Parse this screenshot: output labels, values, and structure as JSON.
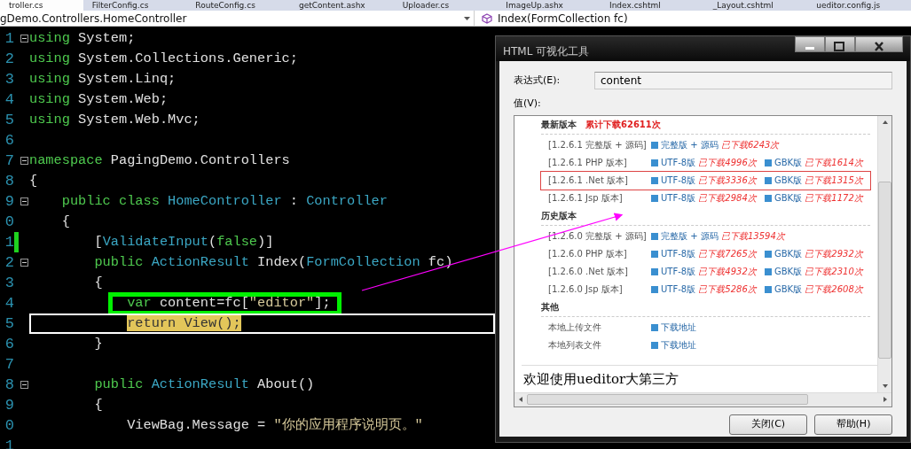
{
  "editor_tabs": [
    {
      "label": "troller.cs",
      "selected": true
    },
    {
      "label": "FilterConfig.cs",
      "selected": false
    },
    {
      "label": "RouteConfig.cs",
      "selected": false
    },
    {
      "label": "getContent.ashx",
      "selected": false
    },
    {
      "label": "Uploader.cs",
      "selected": false
    },
    {
      "label": "ImageUp.ashx",
      "selected": false
    },
    {
      "label": "Index.cshtml",
      "selected": false
    },
    {
      "label": "_Layout.cshtml",
      "selected": false
    },
    {
      "label": "ueditor.config.js",
      "selected": false
    }
  ],
  "navigation": {
    "type_dropdown": "gDemo.Controllers.HomeController",
    "member_dropdown": "Index(FormCollection fc)"
  },
  "code_lines": [
    {
      "number": "1",
      "fold": true,
      "changed": false,
      "current": false,
      "boxed": false,
      "tokens": [
        {
          "kind": "kw",
          "text": "using"
        },
        {
          "kind": "plain",
          "text": " System;"
        }
      ]
    },
    {
      "number": "2",
      "fold": false,
      "changed": false,
      "current": false,
      "boxed": false,
      "tokens": [
        {
          "kind": "kw",
          "text": "using"
        },
        {
          "kind": "plain",
          "text": " System.Collections.Generic;"
        }
      ]
    },
    {
      "number": "3",
      "fold": false,
      "changed": false,
      "current": false,
      "boxed": false,
      "tokens": [
        {
          "kind": "kw",
          "text": "using"
        },
        {
          "kind": "plain",
          "text": " System.Linq;"
        }
      ]
    },
    {
      "number": "4",
      "fold": false,
      "changed": false,
      "current": false,
      "boxed": false,
      "tokens": [
        {
          "kind": "kw",
          "text": "using"
        },
        {
          "kind": "plain",
          "text": " System.Web;"
        }
      ]
    },
    {
      "number": "5",
      "fold": false,
      "changed": false,
      "current": false,
      "boxed": false,
      "tokens": [
        {
          "kind": "kw",
          "text": "using"
        },
        {
          "kind": "plain",
          "text": " System.Web.Mvc;"
        }
      ]
    },
    {
      "number": "6",
      "fold": false,
      "changed": false,
      "current": false,
      "boxed": false
    },
    {
      "number": "7",
      "fold": true,
      "changed": false,
      "current": false,
      "boxed": false,
      "tokens": [
        {
          "kind": "kw",
          "text": "namespace"
        },
        {
          "kind": "plain",
          "text": " PagingDemo.Controllers"
        }
      ]
    },
    {
      "number": "8",
      "fold": false,
      "changed": false,
      "current": false,
      "boxed": false,
      "tokens": [
        {
          "kind": "plain",
          "text": "{"
        }
      ]
    },
    {
      "number": "9",
      "fold": true,
      "changed": false,
      "current": false,
      "boxed": false,
      "tokens": [
        {
          "kind": "kw",
          "text": "    public class"
        },
        {
          "kind": "type",
          "text": " HomeController"
        },
        {
          "kind": "plain",
          "text": " : "
        },
        {
          "kind": "type",
          "text": "Controller"
        }
      ]
    },
    {
      "number": "0",
      "fold": false,
      "changed": false,
      "current": false,
      "boxed": false,
      "tokens": [
        {
          "kind": "plain",
          "text": "    {"
        }
      ]
    },
    {
      "number": "1",
      "fold": false,
      "changed": true,
      "current": false,
      "boxed": false,
      "tokens": [
        {
          "kind": "plain",
          "text": "        ["
        },
        {
          "kind": "type",
          "text": "ValidateInput"
        },
        {
          "kind": "plain",
          "text": "("
        },
        {
          "kind": "kw",
          "text": "false"
        },
        {
          "kind": "plain",
          "text": ")]"
        }
      ]
    },
    {
      "number": "2",
      "fold": true,
      "changed": false,
      "current": false,
      "boxed": false,
      "tokens": [
        {
          "kind": "kw",
          "text": "        public"
        },
        {
          "kind": "type",
          "text": " ActionResult"
        },
        {
          "kind": "plain",
          "text": " Index("
        },
        {
          "kind": "type",
          "text": "FormCollection"
        },
        {
          "kind": "plain",
          "text": " fc)"
        }
      ]
    },
    {
      "number": "3",
      "fold": false,
      "changed": false,
      "current": false,
      "boxed": false,
      "tokens": [
        {
          "kind": "plain",
          "text": "        {"
        }
      ]
    },
    {
      "number": "4",
      "fold": false,
      "changed": false,
      "current": false,
      "boxed": true,
      "tokens": [
        {
          "kind": "kw",
          "text": "            var"
        },
        {
          "kind": "plain",
          "text": " content=fc["
        },
        {
          "kind": "str",
          "text": "\"editor\""
        },
        {
          "kind": "plain",
          "text": "];"
        }
      ]
    },
    {
      "number": "5",
      "fold": false,
      "changed": false,
      "current": true,
      "boxed": false,
      "tokens": [
        {
          "kind": "step",
          "text": "            return View();"
        }
      ]
    },
    {
      "number": "6",
      "fold": false,
      "changed": false,
      "current": false,
      "boxed": false,
      "tokens": [
        {
          "kind": "plain",
          "text": "        }"
        }
      ]
    },
    {
      "number": "7",
      "fold": false,
      "changed": false,
      "current": false,
      "boxed": false
    },
    {
      "number": "8",
      "fold": true,
      "changed": false,
      "current": false,
      "boxed": false,
      "tokens": [
        {
          "kind": "kw",
          "text": "        public"
        },
        {
          "kind": "type",
          "text": " ActionResult"
        },
        {
          "kind": "plain",
          "text": " About()"
        }
      ]
    },
    {
      "number": "9",
      "fold": false,
      "changed": false,
      "current": false,
      "boxed": false,
      "tokens": [
        {
          "kind": "plain",
          "text": "        {"
        }
      ]
    },
    {
      "number": "0",
      "fold": false,
      "changed": false,
      "current": false,
      "boxed": false,
      "tokens": [
        {
          "kind": "plain",
          "text": "            ViewBag.Message = "
        },
        {
          "kind": "str",
          "text": "\"你的应用程序说明页。\""
        }
      ]
    },
    {
      "number": "1",
      "fold": false,
      "changed": false,
      "current": false,
      "boxed": false
    }
  ],
  "dialog": {
    "title": "HTML 可视化工具",
    "expression_label": "表达式(E):",
    "expression_value": "content",
    "value_label": "值(V):",
    "preview": {
      "sections": [
        {
          "heading": "最新版本",
          "total": "累计下载62611次",
          "rows": [
            {
              "label": "[1.2.6.1 完整版 + 源码]",
              "outlined": false,
              "links": [
                {
                  "text": "完整版 + 源码",
                  "count": "已下载6243次"
                }
              ]
            },
            {
              "label": "[1.2.6.1 PHP 版本]",
              "outlined": false,
              "links": [
                {
                  "text": "UTF-8版",
                  "count": "已下载4996次"
                },
                {
                  "text": "GBK版",
                  "count": "已下载1614次"
                }
              ]
            },
            {
              "label": "[1.2.6.1 .Net 版本]",
              "outlined": true,
              "links": [
                {
                  "text": "UTF-8版",
                  "count": "已下载3336次"
                },
                {
                  "text": "GBK版",
                  "count": "已下载1315次"
                }
              ]
            },
            {
              "label": "[1.2.6.1 Jsp 版本]",
              "outlined": false,
              "links": [
                {
                  "text": "UTF-8版",
                  "count": "已下载2984次"
                },
                {
                  "text": "GBK版",
                  "count": "已下载1172次"
                }
              ]
            }
          ]
        },
        {
          "heading": "历史版本",
          "rows": [
            {
              "label": "[1.2.6.0 完整版 + 源码]",
              "outlined": false,
              "links": [
                {
                  "text": "完整版 + 源码",
                  "count": "已下载13594次"
                }
              ]
            },
            {
              "label": "[1.2.6.0 PHP 版本]",
              "outlined": false,
              "links": [
                {
                  "text": "UTF-8版",
                  "count": "已下载7265次"
                },
                {
                  "text": "GBK版",
                  "count": "已下载2932次"
                }
              ]
            },
            {
              "label": "[1.2.6.0 .Net 版本]",
              "outlined": false,
              "links": [
                {
                  "text": "UTF-8版",
                  "count": "已下载4932次"
                },
                {
                  "text": "GBK版",
                  "count": "已下载2310次"
                }
              ]
            },
            {
              "label": "[1.2.6.0 Jsp 版本]",
              "outlined": false,
              "links": [
                {
                  "text": "UTF-8版",
                  "count": "已下载5286次"
                },
                {
                  "text": "GBK版",
                  "count": "已下载2608次"
                }
              ]
            }
          ]
        },
        {
          "heading": "其他",
          "rows": [
            {
              "label": "本地上传文件",
              "outlined": false,
              "links": [
                {
                  "text": "下载地址"
                }
              ]
            },
            {
              "label": "本地列表文件",
              "outlined": false,
              "links": [
                {
                  "text": "下载地址"
                }
              ]
            }
          ]
        }
      ],
      "body_text": "欢迎使用ueditor大第三方"
    },
    "buttons": [
      "关闭(C)",
      "帮助(H)"
    ]
  }
}
